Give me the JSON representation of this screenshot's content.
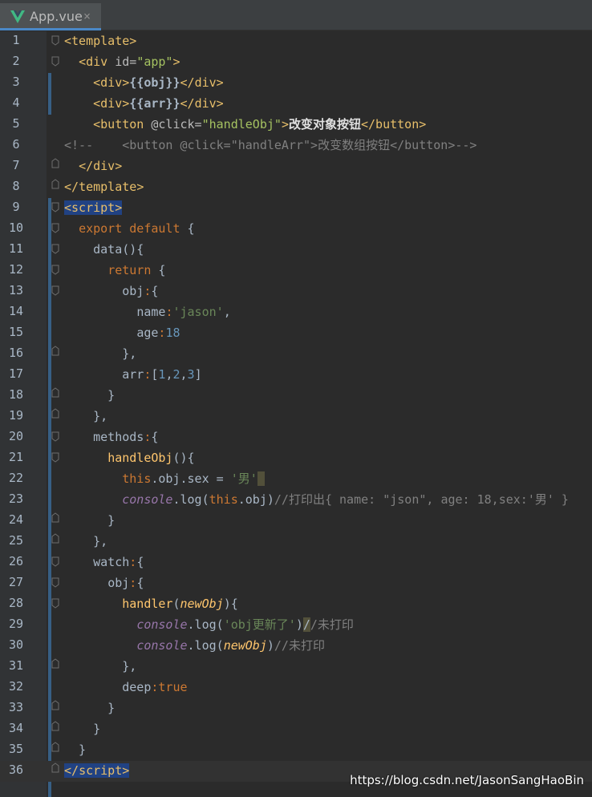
{
  "tab": {
    "label": "App.vue",
    "close": "×"
  },
  "lines": [
    {
      "n": "1"
    },
    {
      "n": "2"
    },
    {
      "n": "3"
    },
    {
      "n": "4"
    },
    {
      "n": "5"
    },
    {
      "n": "6"
    },
    {
      "n": "7"
    },
    {
      "n": "8"
    },
    {
      "n": "9"
    },
    {
      "n": "10"
    },
    {
      "n": "11"
    },
    {
      "n": "12"
    },
    {
      "n": "13"
    },
    {
      "n": "14"
    },
    {
      "n": "15"
    },
    {
      "n": "16"
    },
    {
      "n": "17"
    },
    {
      "n": "18"
    },
    {
      "n": "19"
    },
    {
      "n": "20"
    },
    {
      "n": "21"
    },
    {
      "n": "22"
    },
    {
      "n": "23"
    },
    {
      "n": "24"
    },
    {
      "n": "25"
    },
    {
      "n": "26"
    },
    {
      "n": "27"
    },
    {
      "n": "28"
    },
    {
      "n": "29"
    },
    {
      "n": "30"
    },
    {
      "n": "31"
    },
    {
      "n": "32"
    },
    {
      "n": "33"
    },
    {
      "n": "34"
    },
    {
      "n": "35"
    },
    {
      "n": "36"
    }
  ],
  "code": {
    "template_open": "template",
    "div": "div",
    "id_attr": "id=",
    "app_val": "\"app\"",
    "obj_expr": "{{obj}}",
    "arr_expr": "{{arr}}",
    "button": "button",
    "click_attr": "@click=",
    "handle_obj_val": "\"handleObj\"",
    "btn_text": "改变对象按钮",
    "comment_line": "<!--    <button @click=\"handleArr\">改变数组按钮</button>-->",
    "script": "script",
    "export_default": "export default",
    "data_fn": "data(){",
    "return_kw": "return",
    "obj_key": "obj",
    "name_key": "name",
    "name_val": "'jason'",
    "age_key": "age",
    "age_val": "18",
    "arr_key": "arr",
    "arr_v1": "1",
    "arr_v2": "2",
    "arr_v3": "3",
    "methods_key": "methods",
    "handle_obj_fn": "handleObj",
    "this_kw": "this",
    "sex_assign": ".obj.sex = ",
    "sex_val": "'男'",
    "console": "console",
    "log": ".log(",
    "obj_ref": ".obj)",
    "cmt_23": "//打印出{ name: \"json\", age: 18,sex:'男' }",
    "watch_key": "watch",
    "handler_fn": "handler",
    "new_obj": "newObj",
    "log_str": "'obj更新了'",
    "cmt_29": "/未打印",
    "cmt_30": "//未打印",
    "deep_key": "deep",
    "true_kw": "true"
  },
  "watermark": "https://blog.csdn.net/JasonSangHaoBin"
}
